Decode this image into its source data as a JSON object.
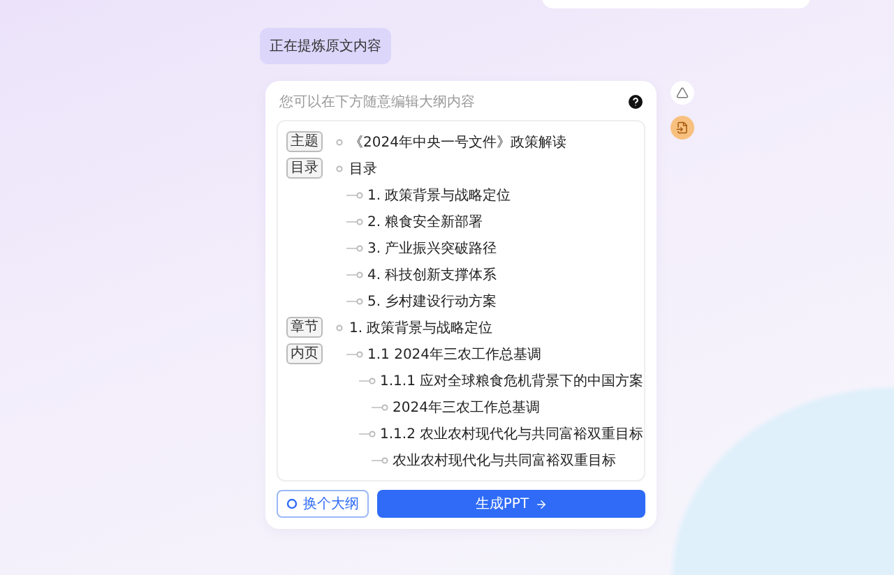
{
  "status_message": "正在提炼原文内容",
  "outline_editor": {
    "hint": "您可以在下方随意编辑大纲内容",
    "rows": [
      {
        "tag": "主题",
        "text": "《2024年中央一号文件》政策解读"
      },
      {
        "tag": "目录",
        "text": "目录",
        "children": [
          {
            "text": "1. 政策背景与战略定位"
          },
          {
            "text": "2. 粮食安全新部署"
          },
          {
            "text": "3. 产业振兴突破路径"
          },
          {
            "text": "4. 科技创新支撑体系"
          },
          {
            "text": "5. 乡村建设行动方案"
          }
        ]
      },
      {
        "tag": "章节",
        "text": "1. 政策背景与战略定位",
        "children": [
          {
            "tag": "内页",
            "text": "1.1 2024年三农工作总基调",
            "children": [
              {
                "text": "1.1.1 应对全球粮食危机背景下的中国方案",
                "children": [
                  {
                    "text": "2024年三农工作总基调"
                  }
                ]
              },
              {
                "text": "1.1.2 农业农村现代化与共同富裕双重目标",
                "children": [
                  {
                    "text": "农业农村现代化与共同富裕双重目标"
                  }
                ]
              }
            ]
          }
        ]
      }
    ]
  },
  "buttons": [
    {
      "kind": "outline",
      "label": "换个大纲"
    },
    {
      "kind": "primary",
      "label": "生成PPT"
    }
  ]
}
